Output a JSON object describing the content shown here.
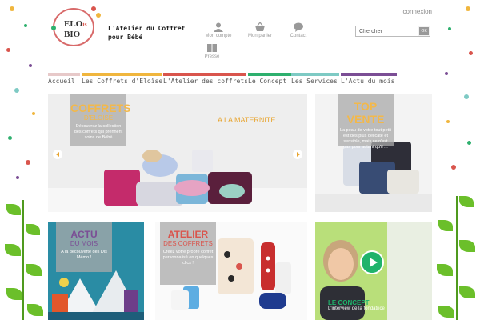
{
  "header": {
    "logo_lines": [
      "ELO",
      "is",
      "BIO"
    ],
    "tagline_line1": "L'Atelier du Coffret",
    "tagline_line2": "pour Bébé",
    "connexion": "connexion",
    "search_value": "Chercher",
    "search_button": "OK",
    "nav": [
      {
        "label": "Mon compte",
        "icon": "user-icon"
      },
      {
        "label": "Mon panier",
        "icon": "basket-icon"
      },
      {
        "label": "Contact",
        "icon": "chat-icon"
      },
      {
        "label": "Presse",
        "icon": "book-icon"
      }
    ]
  },
  "menu": [
    {
      "label": "Accueil",
      "color": "#e7c9c9"
    },
    {
      "label": "Les Coffrets d'Eloïse",
      "color": "#f0b63e"
    },
    {
      "label": "L'Atelier des coffrets",
      "color": "#d9554d"
    },
    {
      "label": "Le Concept",
      "color": "#2eb06e"
    },
    {
      "label": "Les Services",
      "color": "#7ecac4"
    },
    {
      "label": "L'Actu du mois",
      "color": "#7b4e95"
    }
  ],
  "banner": {
    "title": "COFFRETS",
    "subtitle": "D'ELOISE",
    "text": "Découvrez la collection des coffrets qui prennent soins de Bébé",
    "right_text": "A LA MATERNITE"
  },
  "topvente": {
    "title": "TOP VENTE",
    "text": "La peau de votre tout petit est des plus délicate et sensible, mais ce n'est pas pour autant qu'il ..."
  },
  "actu": {
    "title": "ACTU",
    "subtitle": "DU MOIS",
    "text": "A la découverte des Dis Mémo !"
  },
  "atelier": {
    "title": "ATELIER",
    "subtitle": "DES COFFRETS",
    "text": "Créez votre propre coffret personnalisé en quelques clics !"
  },
  "concept": {
    "title": "LE CONCEPT",
    "text": "L'interview de la fondatrice"
  },
  "colors": {
    "accent_orange": "#f0b63e",
    "accent_red": "#d9554d",
    "accent_green": "#2eb06e",
    "accent_purple": "#7b4e95"
  }
}
